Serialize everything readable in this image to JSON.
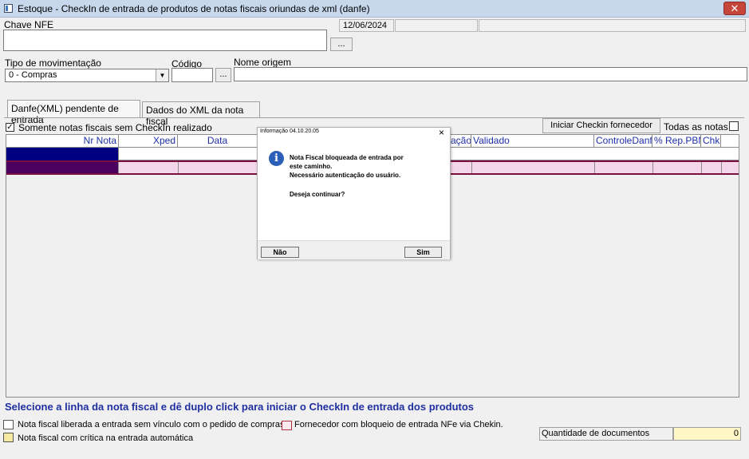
{
  "window": {
    "title": "Estoque - CheckIn de entrada de produtos de notas fiscais oriundas de xml (danfe)",
    "close_label": "✕"
  },
  "form": {
    "chave_label": "Chave NFE",
    "chave_value": "",
    "date_value": "12/06/2024",
    "ellipsis": "...",
    "tipo_label": "Tipo de movimentação",
    "tipo_value": "0 - Compras",
    "codigo_label": "Código",
    "codigo_value": "",
    "nome_label": "Nome origem",
    "nome_value": ""
  },
  "tabs": [
    {
      "label": "Danfe(XML) pendente de entrada",
      "active": true
    },
    {
      "label": "Dados do XML da nota fiscal",
      "active": false
    }
  ],
  "toolbar": {
    "only_without_checkin_label": "Somente notas fiscais sem CheckIn realizado",
    "only_without_checkin_checked": true,
    "start_checkin_label": "Iniciar Checkin fornecedor",
    "all_notes_label": "Todas as notas",
    "all_notes_checked": false
  },
  "grid": {
    "columns": [
      "Nr Nota",
      "Xped",
      "Data",
      "ação",
      "Validado",
      "ControleDanfe",
      "% Rep.PBM",
      "Chk."
    ]
  },
  "dialog": {
    "title": "Informação 04.10.20.05",
    "close": "×",
    "message_lines": [
      "Nota Fiscal bloqueada de entrada por",
      "este caminho.",
      "Necessário autenticação do usuário."
    ],
    "question": "Deseja continuar?",
    "no_label": "Não",
    "yes_label": "Sim",
    "icon": "info-icon"
  },
  "footer": {
    "instruction": "Selecione a linha da nota fiscal  e dê duplo click para iniciar o CheckIn de entrada dos produtos",
    "legend": [
      {
        "label": "Nota fiscal liberada a entrada sem vínculo com o pedido de compras",
        "color": "#ffffff",
        "border": "#555555"
      },
      {
        "label": "Nota fiscal com crítica na entrada automática",
        "color": "#f5e9a2",
        "border": "#555555"
      },
      {
        "label": "Fornecedor com bloqueio de entrada NFe via Chekin.",
        "color": "#f8e8f0",
        "border": "#b03040"
      }
    ],
    "quantidade_label": "Quantidade de documentos",
    "quantidade_value": "0"
  },
  "colors": {
    "selected_cell": "#000080",
    "row_highlight": "#4b0060",
    "row_pink": "#f3d6ea",
    "header_text": "#1d2fa8"
  }
}
